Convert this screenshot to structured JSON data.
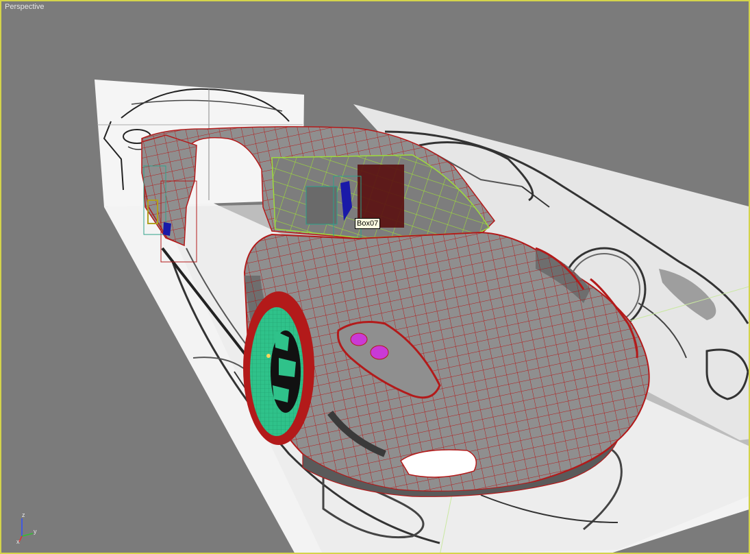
{
  "viewport": {
    "label": "Perspective",
    "border_color": "#d4d44a",
    "background_color": "#7b7b7b"
  },
  "tooltip": {
    "object_name": "Box07"
  },
  "axis_gizmo": {
    "x_label": "x",
    "y_label": "y",
    "z_label": "z"
  },
  "colors": {
    "wire_red": "#b31a1a",
    "body_gray": "#8f8f8f",
    "wheel_green": "#2fc28a",
    "glass_wire": "#9fdc3a",
    "headlight_magenta": "#c93ad6",
    "blueprint_plane": "#f2f2f2"
  },
  "icons": {
    "axis": "axis-tripod-icon"
  }
}
